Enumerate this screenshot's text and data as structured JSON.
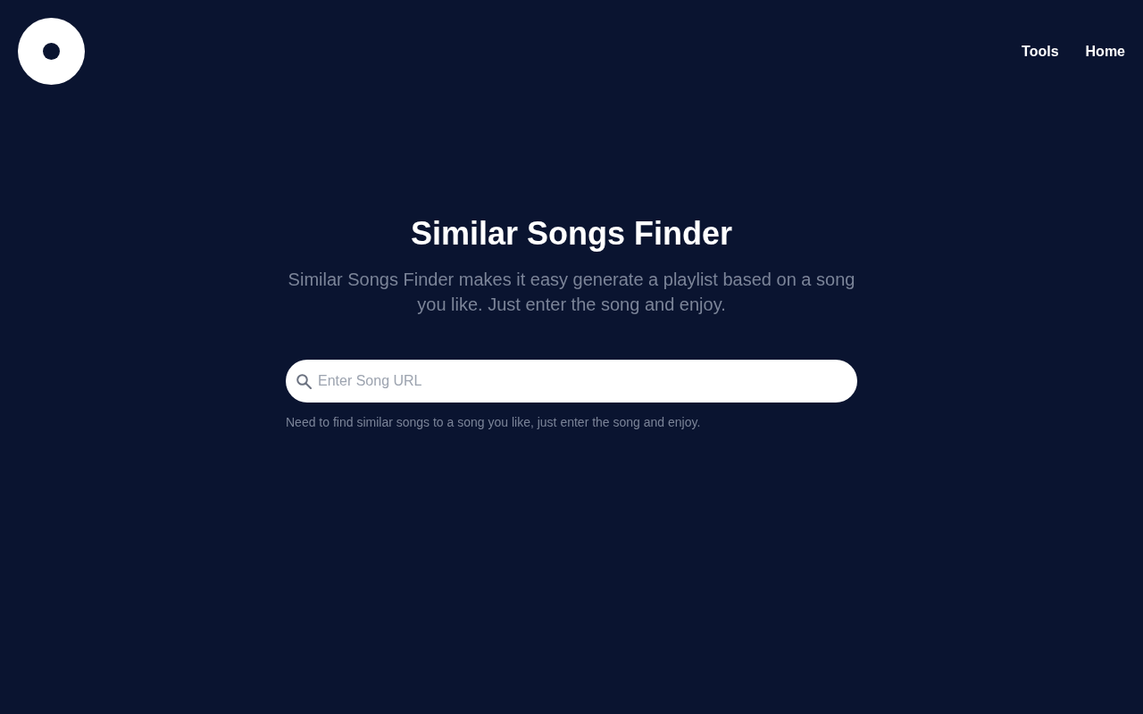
{
  "nav": {
    "links": [
      "Tools",
      "Home"
    ]
  },
  "hero": {
    "title": "Similar Songs Finder",
    "subtitle": "Similar Songs Finder makes it easy generate a playlist based on a song you like. Just enter the song and enjoy."
  },
  "search": {
    "placeholder": "Enter Song URL"
  },
  "helper_text": "Need to find similar songs to a song you like, just enter the song and enjoy."
}
